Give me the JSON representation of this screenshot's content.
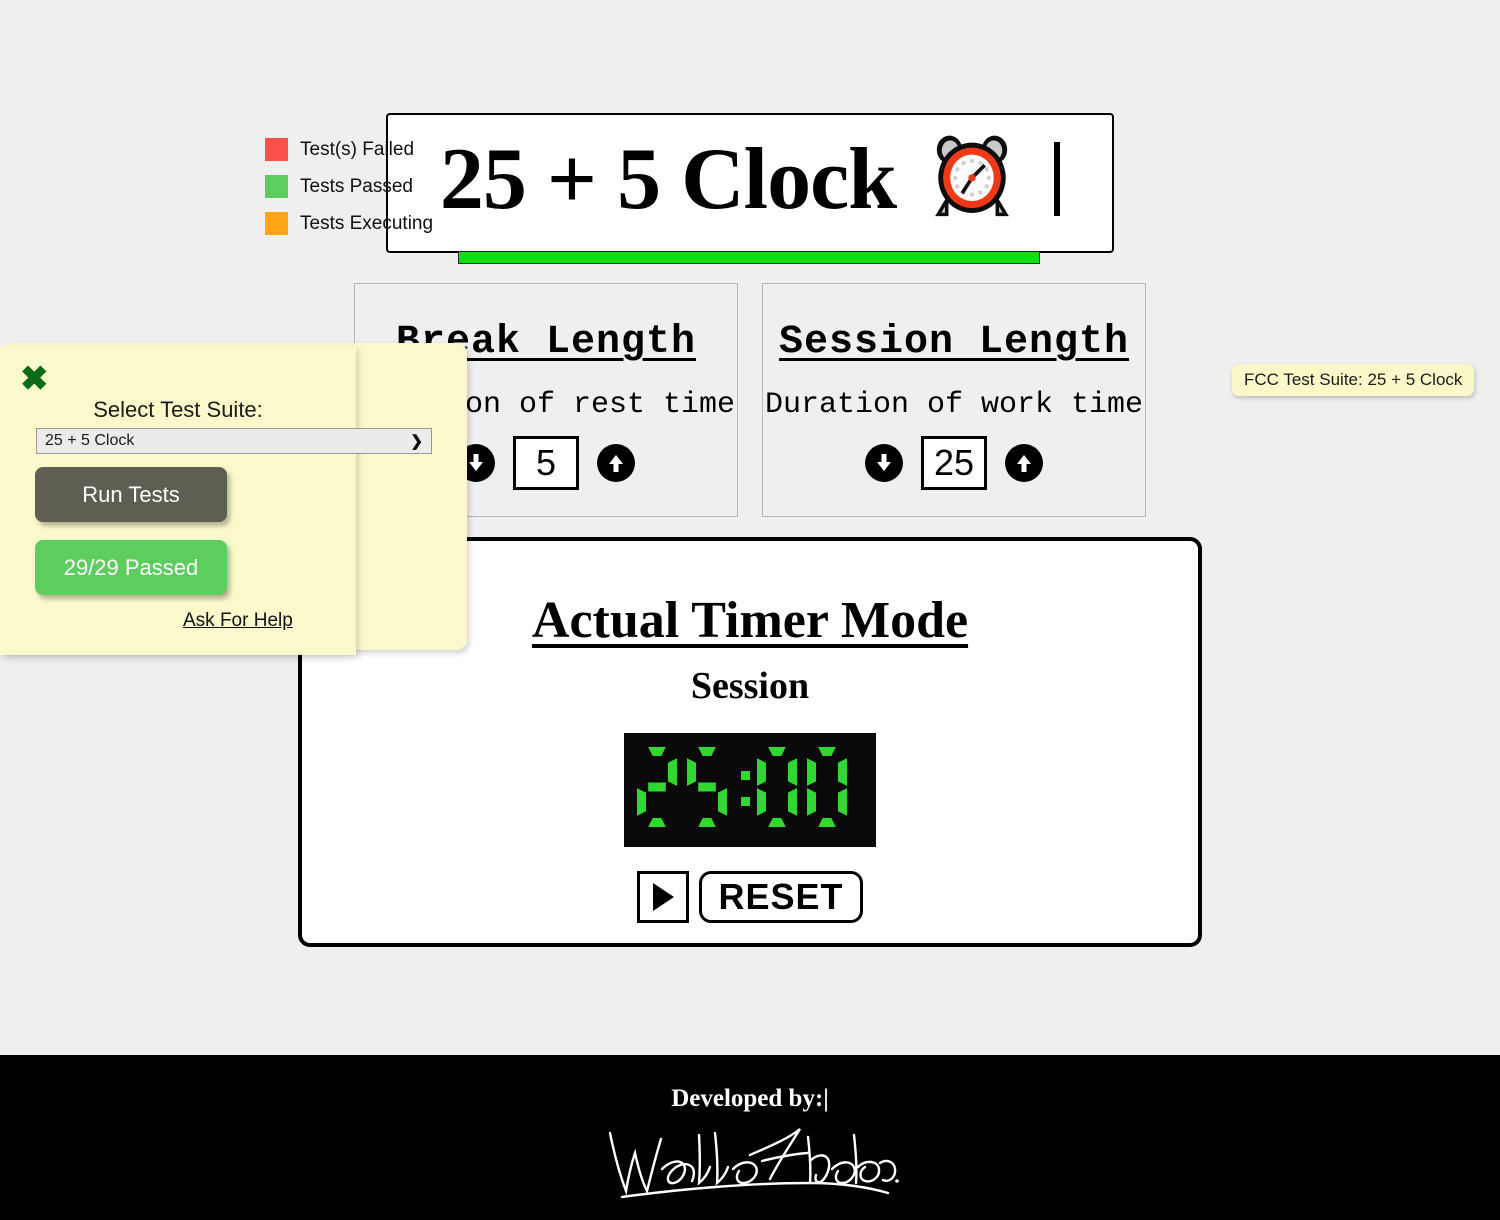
{
  "app": {
    "title": "25 + 5 Clock",
    "title_icon": "alarm-clock-emoji",
    "caret": "|",
    "break": {
      "title": "Break Length",
      "description": "Duration of rest time",
      "value": "5",
      "decrement_icon": "arrow-down-icon",
      "increment_icon": "arrow-up-icon"
    },
    "session": {
      "title": "Session Length",
      "description": "Duration of work time",
      "value": "25",
      "decrement_icon": "arrow-down-icon",
      "increment_icon": "arrow-up-icon"
    },
    "timer": {
      "mode_heading": "Actual Timer Mode",
      "label": "Session",
      "display": "25:00",
      "display_color": "#2fd92f",
      "display_background": "#0a0a0a",
      "play_icon": "play-triangle-icon",
      "reset_label": "RESET"
    },
    "footer": {
      "credit": "Developed by:|",
      "signature": "Waldo Hidalgo"
    },
    "colors": {
      "page_background": "#efefef",
      "progress_bar": "#0be00b",
      "footer_background": "#000000"
    }
  },
  "fcc": {
    "tooltip": "FCC Test Suite: 25 + 5 Clock",
    "close_icon": "close-x-icon",
    "suite_label": "Select Test Suite:",
    "selected_suite": "25 + 5 Clock",
    "suite_options": [
      "25 + 5 Clock"
    ],
    "dropdown_icon": "chevron-down-icon",
    "run_tests_label": "Run Tests",
    "result_label": "29/29 Passed",
    "ask_for_help_label": "Ask For Help",
    "panel_background": "#f9f9cc",
    "legend": [
      {
        "label": "Test(s) Failed",
        "color": "#f9504a"
      },
      {
        "label": "Tests Passed",
        "color": "#5dce5d"
      },
      {
        "label": "Tests Executing",
        "color": "#ffa515"
      }
    ]
  }
}
